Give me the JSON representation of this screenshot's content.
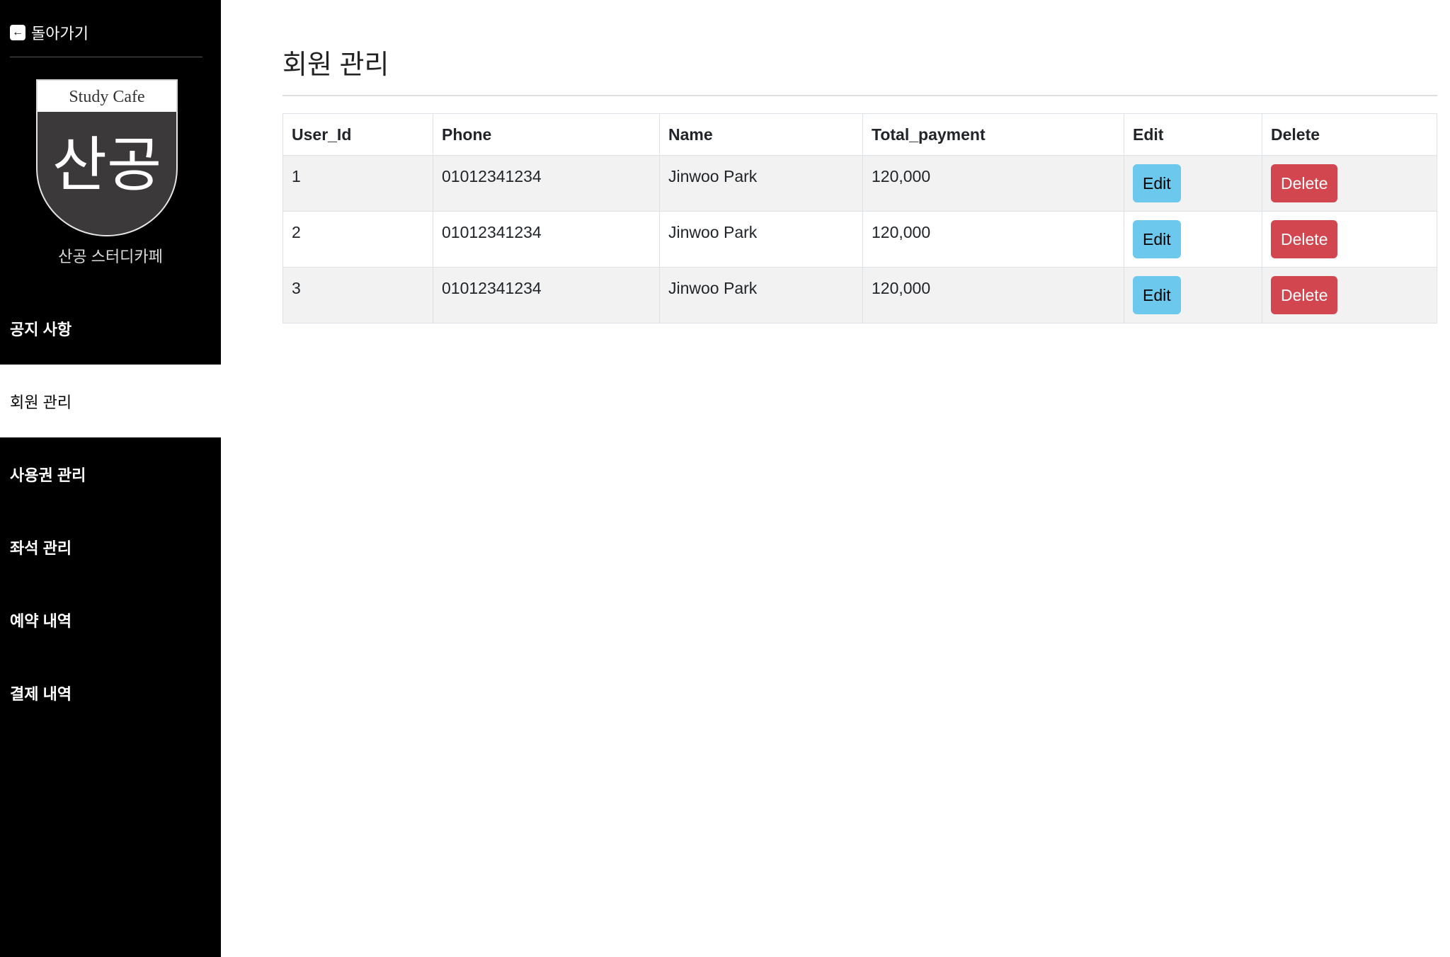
{
  "sidebar": {
    "back_label": "돌아가기",
    "back_icon": "arrow-left-icon",
    "logo": {
      "top_text": "Study Cafe",
      "main_text": "산공"
    },
    "subtitle": "산공 스터디카페",
    "items": [
      {
        "label": "공지 사항",
        "active": false
      },
      {
        "label": "회원 관리",
        "active": true
      },
      {
        "label": "사용권 관리",
        "active": false
      },
      {
        "label": "좌석 관리",
        "active": false
      },
      {
        "label": "예약 내역",
        "active": false
      },
      {
        "label": "결제 내역",
        "active": false
      }
    ]
  },
  "main": {
    "title": "회원 관리",
    "table": {
      "headers": [
        "User_Id",
        "Phone",
        "Name",
        "Total_payment",
        "Edit",
        "Delete"
      ],
      "rows": [
        {
          "id": "1",
          "phone": "01012341234",
          "name": "Jinwoo Park",
          "total": "120,000",
          "edit": "Edit",
          "delete": "Delete"
        },
        {
          "id": "2",
          "phone": "01012341234",
          "name": "Jinwoo Park",
          "total": "120,000",
          "edit": "Edit",
          "delete": "Delete"
        },
        {
          "id": "3",
          "phone": "01012341234",
          "name": "Jinwoo Park",
          "total": "120,000",
          "edit": "Edit",
          "delete": "Delete"
        }
      ]
    }
  },
  "colors": {
    "sidebar_bg": "#000000",
    "edit_button": "#6cc8ec",
    "delete_button": "#d2474f"
  }
}
